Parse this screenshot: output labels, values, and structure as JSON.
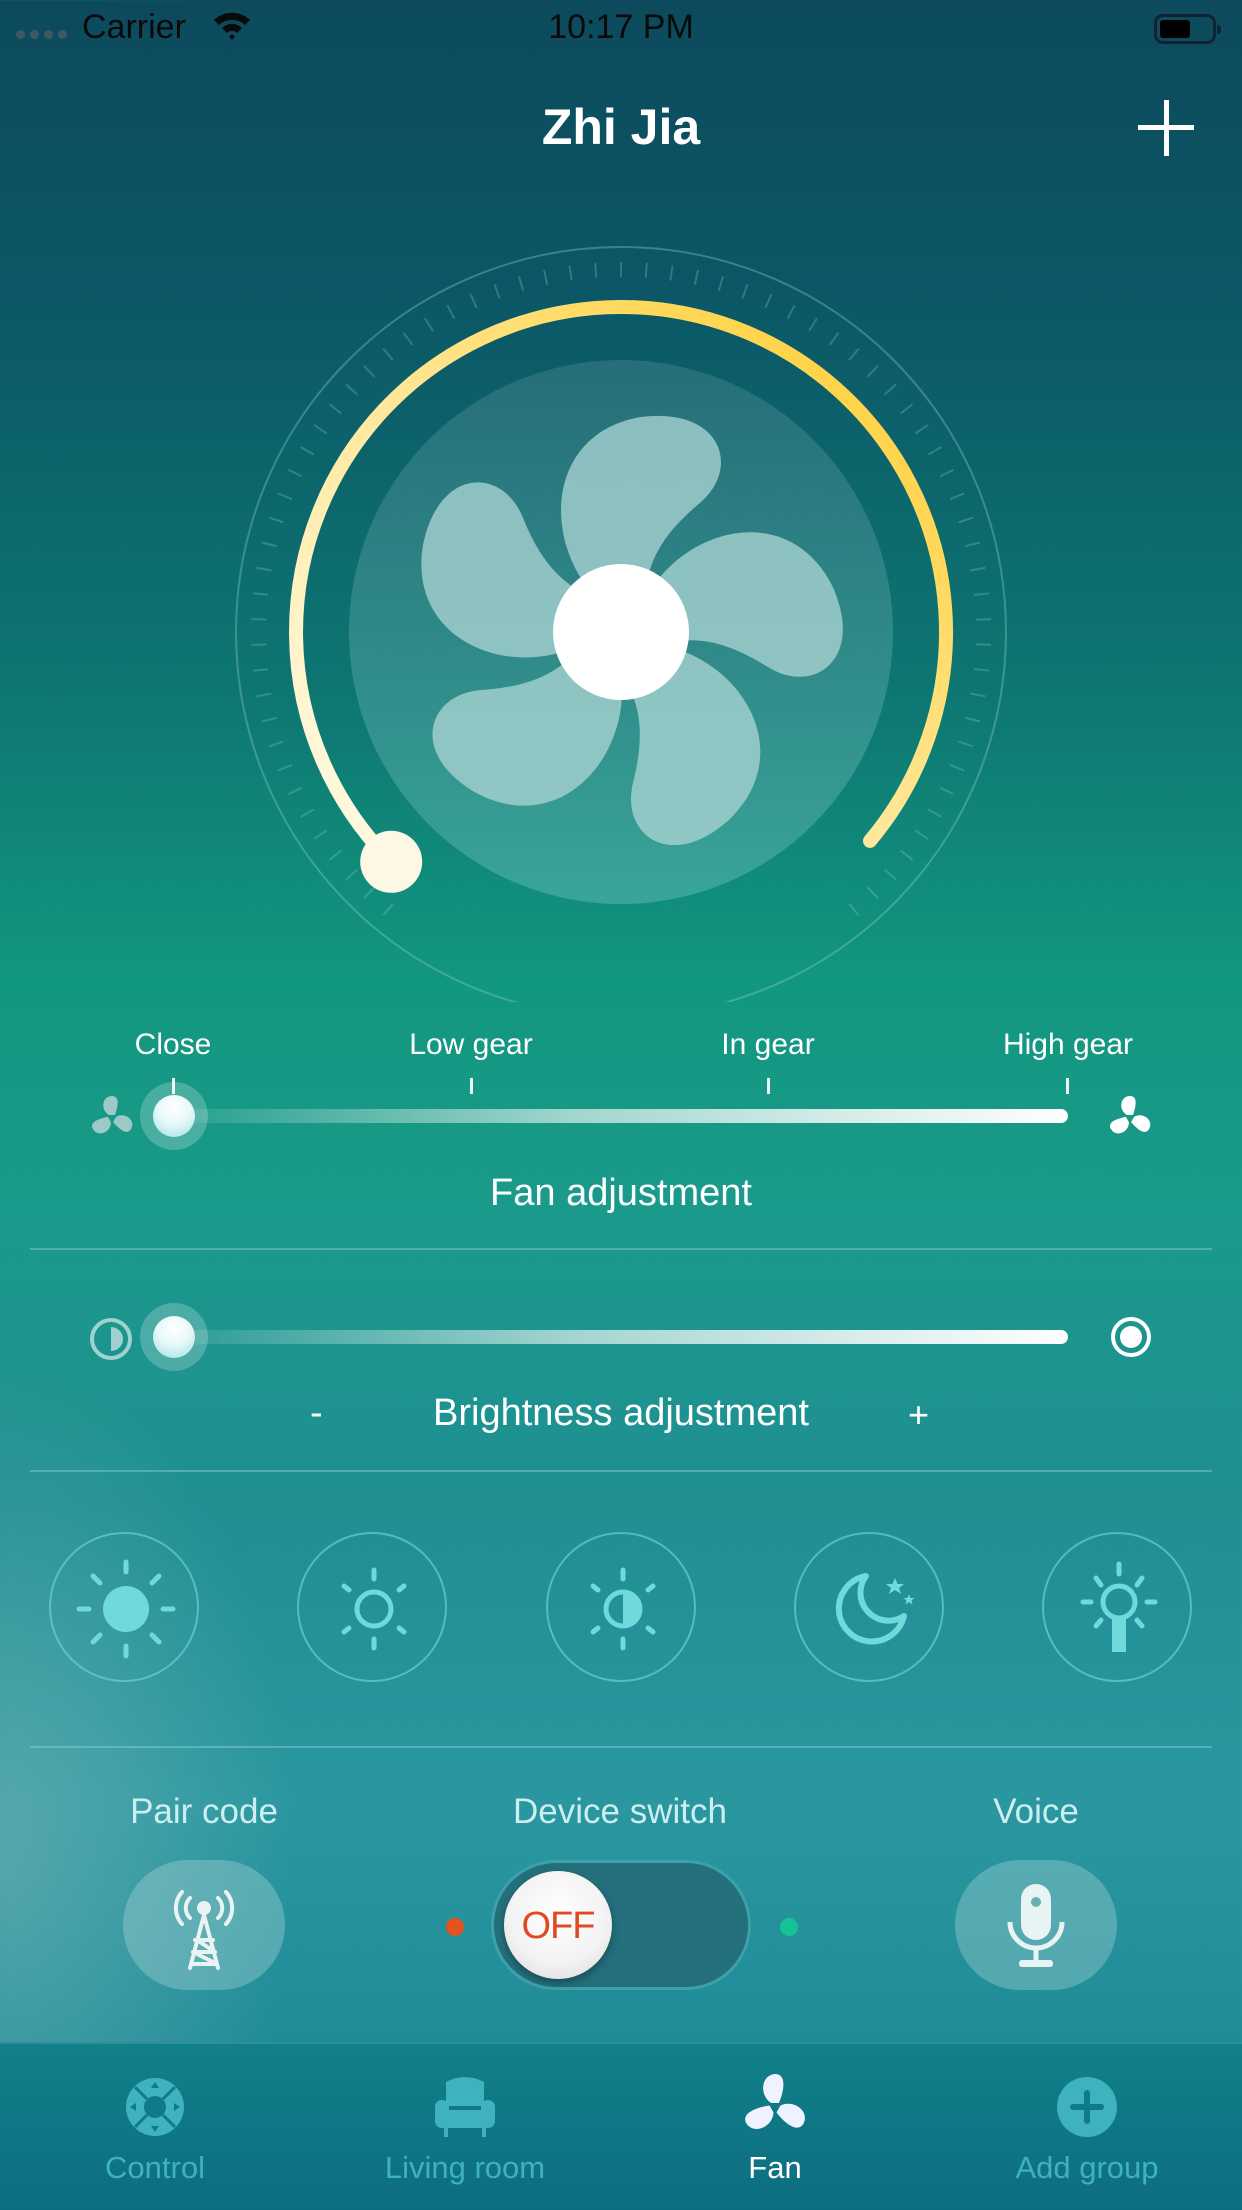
{
  "status_bar": {
    "carrier": "Carrier",
    "time": "10:17 PM",
    "wifi_icon": "wifi-icon",
    "battery_icon": "battery-icon"
  },
  "header": {
    "title": "Zhi Jia",
    "add_icon": "plus-icon"
  },
  "gauge": {
    "center_icon": "fan-icon",
    "arc_colors": [
      "#fffbea",
      "#ffd23a"
    ],
    "knob_position": "start"
  },
  "fan_slider": {
    "gears": [
      "Close",
      "Low gear",
      "In gear",
      "High gear"
    ],
    "selected_gear": "Close",
    "value_fraction": 0,
    "caption": "Fan adjustment",
    "left_icon": "fan-small-icon",
    "right_icon": "fan-large-icon"
  },
  "brightness_slider": {
    "value_fraction": 0,
    "caption": "Brightness adjustment",
    "minus_label": "-",
    "plus_label": "+",
    "left_icon": "half-brightness-icon",
    "right_icon": "full-brightness-icon"
  },
  "modes": [
    {
      "name": "bright-sun",
      "icon": "sun-filled-icon"
    },
    {
      "name": "sun-outline",
      "icon": "sun-outline-icon"
    },
    {
      "name": "half-light",
      "icon": "sun-half-icon"
    },
    {
      "name": "night",
      "icon": "moon-stars-icon"
    },
    {
      "name": "lamp",
      "icon": "lamp-icon"
    }
  ],
  "controls": {
    "pair_code_label": "Pair code",
    "device_switch_label": "Device switch",
    "voice_label": "Voice",
    "switch_state": "OFF",
    "off_dot_color": "#e2531f",
    "on_dot_color": "#16c295"
  },
  "tabbar": {
    "tabs": [
      {
        "label": "Control",
        "icon": "control-dpad-icon",
        "active": false
      },
      {
        "label": "Living room",
        "icon": "armchair-icon",
        "active": false
      },
      {
        "label": "Fan",
        "icon": "fan-icon",
        "active": true
      },
      {
        "label": "Add group",
        "icon": "add-circle-icon",
        "active": false
      }
    ]
  },
  "colors": {
    "accent_cyan": "#6fd9dc",
    "gauge_yellow": "#ffd23a",
    "switch_off_text": "#e04a22"
  }
}
